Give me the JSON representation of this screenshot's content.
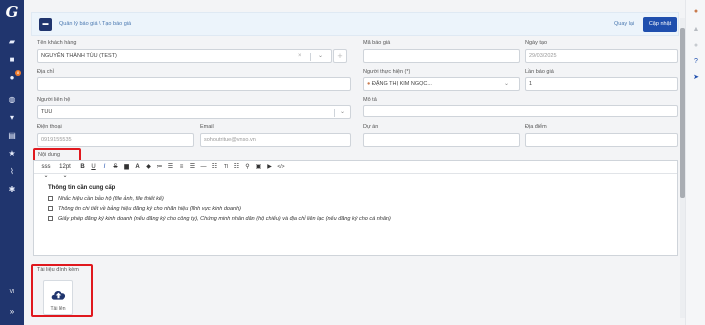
{
  "sidebar": {
    "logo": "G",
    "badge": "8",
    "language": "VI",
    "items": [
      "dashboard-icon",
      "briefcase-icon",
      "people-icon",
      "globe-icon",
      "cart-icon",
      "quote-icon",
      "star-icon",
      "chart-icon",
      "gear-icon"
    ]
  },
  "header": {
    "breadcrumb": "Quản lý báo giá \\ Tạo báo giá",
    "back_label": "Quay lại",
    "save_label": "Cập nhật"
  },
  "form": {
    "customer_label": "Tên khách hàng",
    "customer_value": "NGUYỄN THÀNH TÙU (TEST)",
    "quote_code_label": "Mã báo giá",
    "date_label": "Ngày tạo",
    "date_value": "29/03/2025",
    "address_label": "Địa chỉ",
    "performer_label": "Người thực hiện (*)",
    "performer_value": "ĐẶNG THỊ KIM NGỌC...",
    "times_label": "Lần báo giá",
    "times_value": "1",
    "contact_label": "Người liên hệ",
    "contact_value": "TUU",
    "description_label": "Mô tả",
    "phone_label": "Điện thoại",
    "phone_value": "0919155535",
    "email_label": "Email",
    "email_value": "sohoutritue@vnso.vn",
    "project_label": "Dự án",
    "location_label": "Địa điểm",
    "content_label": "Nội dung"
  },
  "editor": {
    "font_select": "sss",
    "size_select": "12pt",
    "heading": "Thông tin cần cung cấp",
    "lines": [
      "Nhắc hiệu cần bảo hộ (file ảnh, file thiết kế)",
      "Thông tin chi tiết về bảng hiệu đăng ký cho nhãn hiệu (lĩnh vực kinh doanh)",
      "Giấy phép đăng ký kinh doanh (nếu đăng ký cho công ty), Chứng minh nhân dân (hộ chiếu) và địa chỉ liên lạc (nếu đăng ký cho cá nhân)"
    ]
  },
  "attachments": {
    "label": "Tài liệu đính kèm",
    "upload_label": "Tải lên"
  },
  "colors": {
    "sidebar": "#20356e",
    "primary_button": "#1f4fae",
    "highlight": "#e0181e"
  }
}
